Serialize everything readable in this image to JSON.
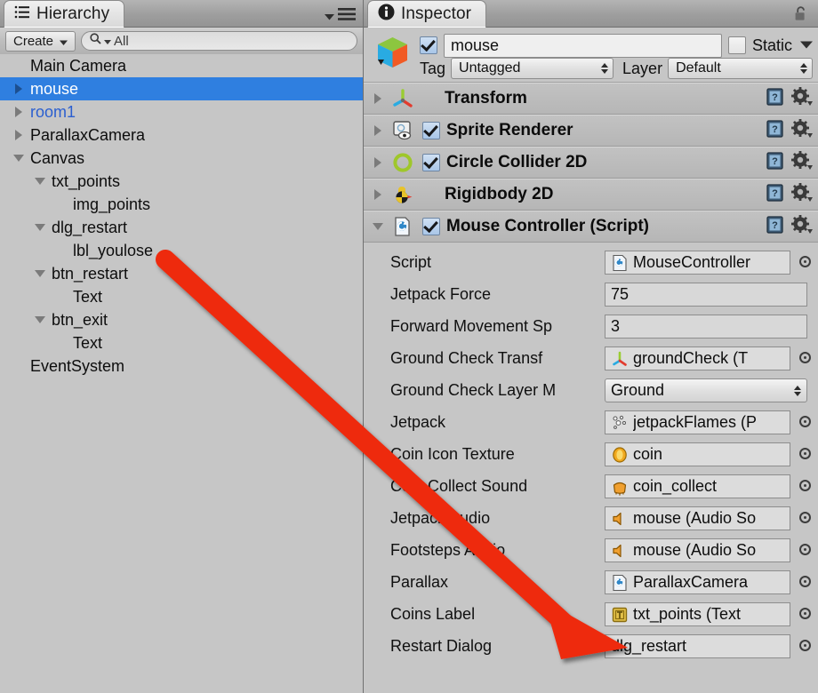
{
  "hierarchy": {
    "tab_label": "Hierarchy",
    "tab_icon": "hierarchy-list-icon",
    "menu_icon": "panel-menu-icon",
    "create_label": "Create",
    "create_icon": "chevron-down-icon",
    "search_icon": "search-icon",
    "search_value": "All",
    "search_placeholder": "All",
    "items": [
      {
        "label": "Main Camera",
        "depth": 0,
        "toggle": "none",
        "state": "normal"
      },
      {
        "label": "mouse",
        "depth": 0,
        "toggle": "right",
        "state": "selected"
      },
      {
        "label": "room1",
        "depth": 0,
        "toggle": "right",
        "state": "prefab"
      },
      {
        "label": "ParallaxCamera",
        "depth": 0,
        "toggle": "right",
        "state": "normal"
      },
      {
        "label": "Canvas",
        "depth": 0,
        "toggle": "down",
        "state": "normal"
      },
      {
        "label": "txt_points",
        "depth": 1,
        "toggle": "down",
        "state": "normal"
      },
      {
        "label": "img_points",
        "depth": 2,
        "toggle": "none",
        "state": "normal"
      },
      {
        "label": "dlg_restart",
        "depth": 1,
        "toggle": "down",
        "state": "normal"
      },
      {
        "label": "lbl_youlose",
        "depth": 2,
        "toggle": "none",
        "state": "normal"
      },
      {
        "label": "btn_restart",
        "depth": 1,
        "toggle": "down",
        "state": "normal"
      },
      {
        "label": "Text",
        "depth": 2,
        "toggle": "none",
        "state": "normal"
      },
      {
        "label": "btn_exit",
        "depth": 1,
        "toggle": "down",
        "state": "normal"
      },
      {
        "label": "Text",
        "depth": 2,
        "toggle": "none",
        "state": "normal"
      },
      {
        "label": "EventSystem",
        "depth": 0,
        "toggle": "none",
        "state": "normal"
      }
    ]
  },
  "inspector": {
    "tab_label": "Inspector",
    "tab_icon": "info-circle-icon",
    "lock_icon": "lock-open-icon",
    "object": {
      "icon": "gameobject-cube-icon",
      "enabled": true,
      "name": "mouse",
      "static_label": "Static",
      "static_checked": false,
      "static_dropdown_icon": "chevron-down-icon",
      "tag_label": "Tag",
      "tag_value": "Untagged",
      "layer_label": "Layer",
      "layer_value": "Default"
    },
    "components": [
      {
        "name": "Transform",
        "icon": "transform-axis-icon",
        "expanded": false,
        "has_toggle": false,
        "enabled": false,
        "help_icon": "help-book-icon",
        "gear_icon": "gear-icon"
      },
      {
        "name": "Sprite Renderer",
        "icon": "sprite-renderer-icon",
        "expanded": false,
        "has_toggle": true,
        "enabled": true,
        "help_icon": "help-book-icon",
        "gear_icon": "gear-icon"
      },
      {
        "name": "Circle Collider 2D",
        "icon": "circle-collider-icon",
        "expanded": false,
        "has_toggle": true,
        "enabled": true,
        "help_icon": "help-book-icon",
        "gear_icon": "gear-icon"
      },
      {
        "name": "Rigidbody 2D",
        "icon": "rigidbody-icon",
        "expanded": false,
        "has_toggle": false,
        "enabled": false,
        "help_icon": "help-book-icon",
        "gear_icon": "gear-icon"
      },
      {
        "name": "Mouse Controller (Script)",
        "icon": "cs-script-icon",
        "expanded": true,
        "has_toggle": true,
        "enabled": true,
        "help_icon": "help-book-icon",
        "gear_icon": "gear-icon"
      }
    ],
    "script_properties": [
      {
        "label": "Script",
        "value": "MouseController",
        "icon": "cs-script-icon",
        "field": "object",
        "picker": true
      },
      {
        "label": "Jetpack Force",
        "value": "75",
        "icon": "",
        "field": "number",
        "picker": false
      },
      {
        "label": "Forward Movement Sp",
        "value": "3",
        "icon": "",
        "field": "number",
        "picker": false
      },
      {
        "label": "Ground Check Transf",
        "value": "groundCheck (T",
        "icon": "transform-axis-icon",
        "field": "object",
        "picker": true
      },
      {
        "label": "Ground Check Layer M",
        "value": "Ground",
        "icon": "",
        "field": "layermask",
        "picker": false
      },
      {
        "label": "Jetpack",
        "value": "jetpackFlames (P",
        "icon": "particle-icon",
        "field": "object",
        "picker": true
      },
      {
        "label": "Coin Icon Texture",
        "value": "coin",
        "icon": "coin-icon",
        "field": "object",
        "picker": true
      },
      {
        "label": "Coin Collect Sound",
        "value": "coin_collect",
        "icon": "audioclip-icon",
        "field": "object",
        "picker": true
      },
      {
        "label": "Jetpack Audio",
        "value": "mouse (Audio So",
        "icon": "audiosource-icon",
        "field": "object",
        "picker": true
      },
      {
        "label": "Footsteps Audio",
        "value": "mouse (Audio So",
        "icon": "audiosource-icon",
        "field": "object",
        "picker": true
      },
      {
        "label": "Parallax",
        "value": "ParallaxCamera",
        "icon": "cs-script-icon",
        "field": "object",
        "picker": true
      },
      {
        "label": "Coins Label",
        "value": "txt_points (Text",
        "icon": "text-ui-icon",
        "field": "object",
        "picker": true
      },
      {
        "label": "Restart Dialog",
        "value": "dlg_restart",
        "icon": "",
        "field": "object",
        "picker": true
      }
    ]
  },
  "annotation": {
    "type": "arrow",
    "color": "#ee2a0e",
    "points_to": "Restart Dialog"
  }
}
